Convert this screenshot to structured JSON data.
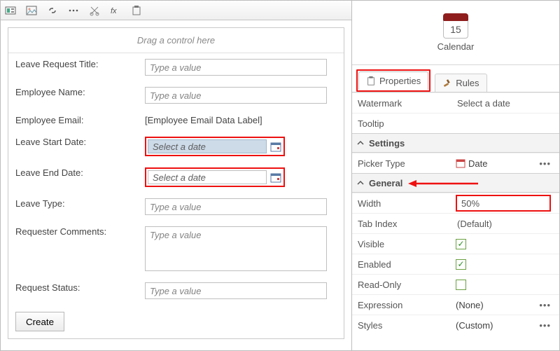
{
  "toolbar_icons": [
    "layout",
    "image",
    "chain",
    "dots",
    "scissors",
    "fx",
    "paste"
  ],
  "drop_hint": "Drag a control here",
  "fields": {
    "leave_title": {
      "label": "Leave Request Title:",
      "placeholder": "Type a value"
    },
    "employee_name": {
      "label": "Employee Name:",
      "placeholder": "Type a value"
    },
    "employee_email": {
      "label": "Employee Email:",
      "value": "[Employee Email Data Label]"
    },
    "leave_start": {
      "label": "Leave Start Date:",
      "placeholder": "Select a date"
    },
    "leave_end": {
      "label": "Leave End Date:",
      "placeholder": "Select a date"
    },
    "leave_type": {
      "label": "Leave Type:",
      "placeholder": "Type a value"
    },
    "requester_comments": {
      "label": "Requester Comments:",
      "placeholder": "Type a value"
    },
    "request_status": {
      "label": "Request Status:",
      "placeholder": "Type a value"
    }
  },
  "create_btn": "Create",
  "right": {
    "cal_day": "15",
    "cal_label": "Calendar",
    "tabs": {
      "properties": "Properties",
      "rules": "Rules"
    },
    "rows": {
      "watermark": {
        "label": "Watermark",
        "value": "Select a date"
      },
      "tooltip": {
        "label": "Tooltip",
        "value": ""
      }
    },
    "sections": {
      "settings": "Settings",
      "general": "General"
    },
    "settings": {
      "picker_type": {
        "label": "Picker Type",
        "value": "Date"
      }
    },
    "general": {
      "width": {
        "label": "Width",
        "value": "50%"
      },
      "tab_index": {
        "label": "Tab Index",
        "value": "(Default)"
      },
      "visible": {
        "label": "Visible"
      },
      "enabled": {
        "label": "Enabled"
      },
      "read_only": {
        "label": "Read-Only"
      },
      "expression": {
        "label": "Expression",
        "value": "(None)"
      },
      "styles": {
        "label": "Styles",
        "value": "(Custom)"
      }
    }
  }
}
